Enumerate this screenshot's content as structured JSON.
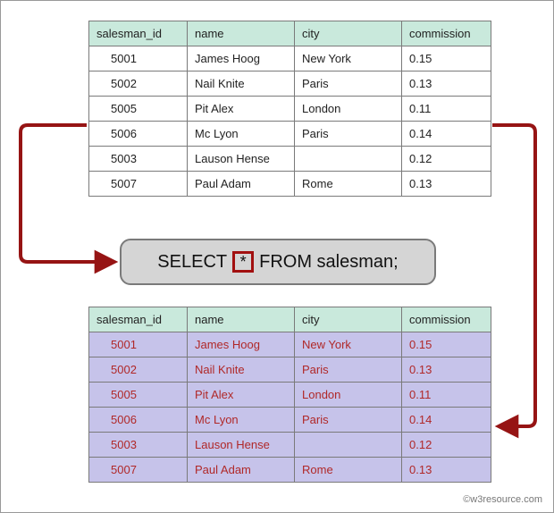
{
  "headers": {
    "salesman_id": "salesman_id",
    "name": "name",
    "city": "city",
    "commission": "commission"
  },
  "rows": [
    {
      "salesman_id": "5001",
      "name": "James Hoog",
      "city": "New York",
      "commission": "0.15"
    },
    {
      "salesman_id": "5002",
      "name": "Nail Knite",
      "city": "Paris",
      "commission": "0.13"
    },
    {
      "salesman_id": "5005",
      "name": "Pit Alex",
      "city": "London",
      "commission": "0.11"
    },
    {
      "salesman_id": "5006",
      "name": "Mc Lyon",
      "city": "Paris",
      "commission": "0.14"
    },
    {
      "salesman_id": "5003",
      "name": "Lauson Hense",
      "city": "",
      "commission": "0.12"
    },
    {
      "salesman_id": "5007",
      "name": "Paul Adam",
      "city": "Rome",
      "commission": "0.13"
    }
  ],
  "query": {
    "select": "SELECT",
    "star": "*",
    "from_clause": "FROM salesman;"
  },
  "attribution": "©w3resource.com"
}
